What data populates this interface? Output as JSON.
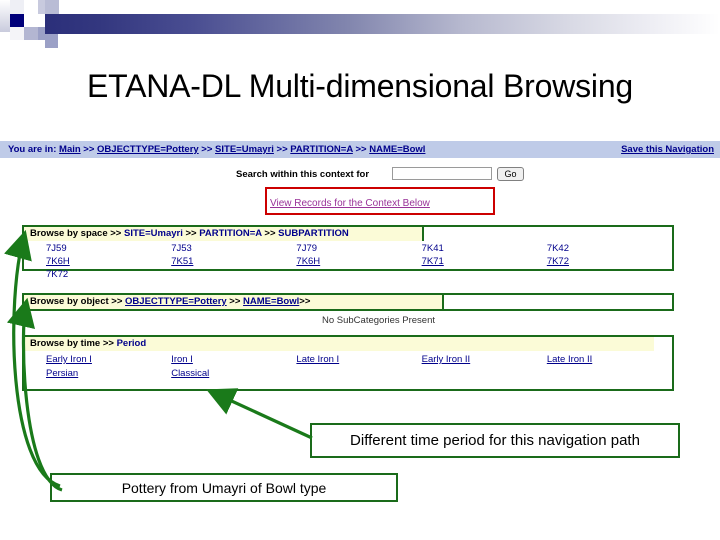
{
  "slide": {
    "title": "ETANA-DL Multi-dimensional Browsing"
  },
  "browser": {
    "breadcrumb": {
      "lead": "You are in: ",
      "items": [
        {
          "label": "Main"
        },
        {
          "label": "OBJECTTYPE=Pottery"
        },
        {
          "label": "SITE=Umayri"
        },
        {
          "label": "PARTITION=A"
        },
        {
          "label": "NAME=Bowl"
        }
      ],
      "separator": " >> ",
      "save_link": "Save this Navigation"
    },
    "search": {
      "label": "Search within this context for",
      "value": "",
      "placeholder": "",
      "go_label": "Go"
    },
    "view_records_link": "View Records for the Context Below",
    "facets": [
      {
        "id": "space",
        "head_title": "Browse by space",
        "head_crumbs": [
          "SITE=Umayri",
          "PARTITION=A",
          "SUBPARTITION"
        ],
        "rows": [
          [
            {
              "text": "7J59",
              "link": false
            },
            {
              "text": "7J53",
              "link": false
            },
            {
              "text": "7J79",
              "link": false
            },
            {
              "text": "7K41",
              "link": false
            },
            {
              "text": "7K42",
              "link": false
            }
          ],
          [
            {
              "text": "7K6H",
              "link": true
            },
            {
              "text": "7K51",
              "link": true
            },
            {
              "text": "7K6H",
              "link": true
            },
            {
              "text": "7K71",
              "link": true
            },
            {
              "text": "7K72",
              "link": true
            }
          ],
          [
            {
              "text": "7K72",
              "link": false
            },
            {
              "text": "",
              "link": false
            },
            {
              "text": "",
              "link": false
            },
            {
              "text": "",
              "link": false
            },
            {
              "text": "",
              "link": false
            }
          ]
        ]
      },
      {
        "id": "object",
        "head_title": "Browse by object",
        "head_crumbs": [
          "OBJECTTYPE=Pottery",
          "NAME=Bowl"
        ],
        "head_trailing": ">>",
        "empty_message": "No SubCategories Present"
      },
      {
        "id": "time",
        "head_title": "Browse by time",
        "head_crumbs": [
          "Period"
        ],
        "rows": [
          [
            "Early Iron I",
            "Iron I",
            "Late Iron I",
            "Early Iron II",
            "Late Iron II"
          ],
          [
            "Persian",
            "Classical",
            "",
            "",
            ""
          ]
        ]
      }
    ]
  },
  "annotations": {
    "time_callout": "Different time period for this navigation path",
    "pottery_callout": "Pottery from Umayri of Bowl type"
  },
  "colors": {
    "header_band_dark": "#2b2f7a",
    "breadcrumb_bg": "#bfcbe8",
    "link_blue": "#00008b",
    "visited_link": "#993399",
    "facet_head_bg": "#fbfbd7",
    "facet_border": "#1a6b1a",
    "highlight_red": "#cc0000",
    "arrow_green": "#1a7a1a"
  }
}
